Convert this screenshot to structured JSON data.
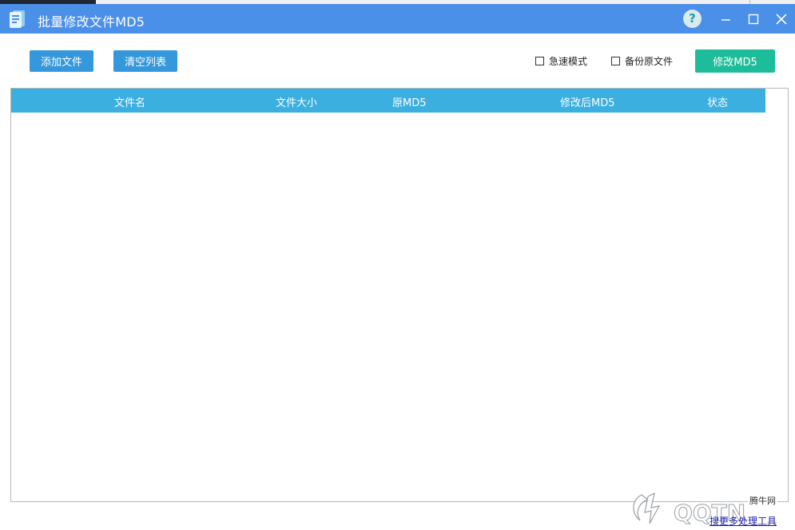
{
  "window": {
    "title": "批量修改文件MD5",
    "help_label": "?"
  },
  "toolbar": {
    "add_file_label": "添加文件",
    "clear_list_label": "清空列表",
    "fast_mode_label": "急速模式",
    "fast_mode_checked": false,
    "backup_label": "备份原文件",
    "backup_checked": false,
    "modify_label": "修改MD5"
  },
  "table": {
    "columns": [
      "文件名",
      "文件大小",
      "原MD5",
      "修改后MD5",
      "状态"
    ],
    "rows": []
  },
  "watermark": {
    "site": "腾牛网",
    "caption": "搜更多处理工具"
  },
  "colors": {
    "titlebar": "#4a8fe8",
    "button_blue": "#3598dc",
    "button_green": "#1dbd9b",
    "table_header": "#3aafe0"
  }
}
